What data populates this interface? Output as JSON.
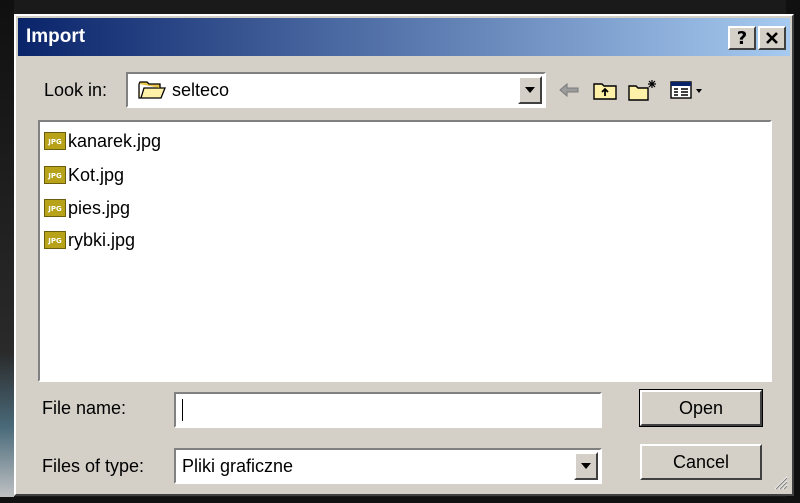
{
  "window": {
    "title": "Import",
    "help_label": "?",
    "close_label": "✕"
  },
  "lookin": {
    "label": "Look in:",
    "value": "selteco",
    "folder_icon": "folder-icon"
  },
  "toolbar": {
    "icons": [
      "back-arrow-icon",
      "up-folder-icon",
      "new-folder-icon",
      "view-menu-icon"
    ]
  },
  "files": [
    {
      "name": "kanarek.jpg",
      "icon_text": "JPG"
    },
    {
      "name": "Kot.jpg",
      "icon_text": "JPG"
    },
    {
      "name": "pies.jpg",
      "icon_text": "JPG"
    },
    {
      "name": "rybki.jpg",
      "icon_text": "JPG"
    }
  ],
  "filename": {
    "label": "File name:",
    "value": ""
  },
  "filetype": {
    "label": "Files of type:",
    "value": "Pliki graficzne"
  },
  "buttons": {
    "open": "Open",
    "cancel": "Cancel"
  },
  "colors": {
    "titlebar_start": "#0a246a",
    "titlebar_end": "#a6caf0",
    "dialog_bg": "#d4d0c8"
  }
}
